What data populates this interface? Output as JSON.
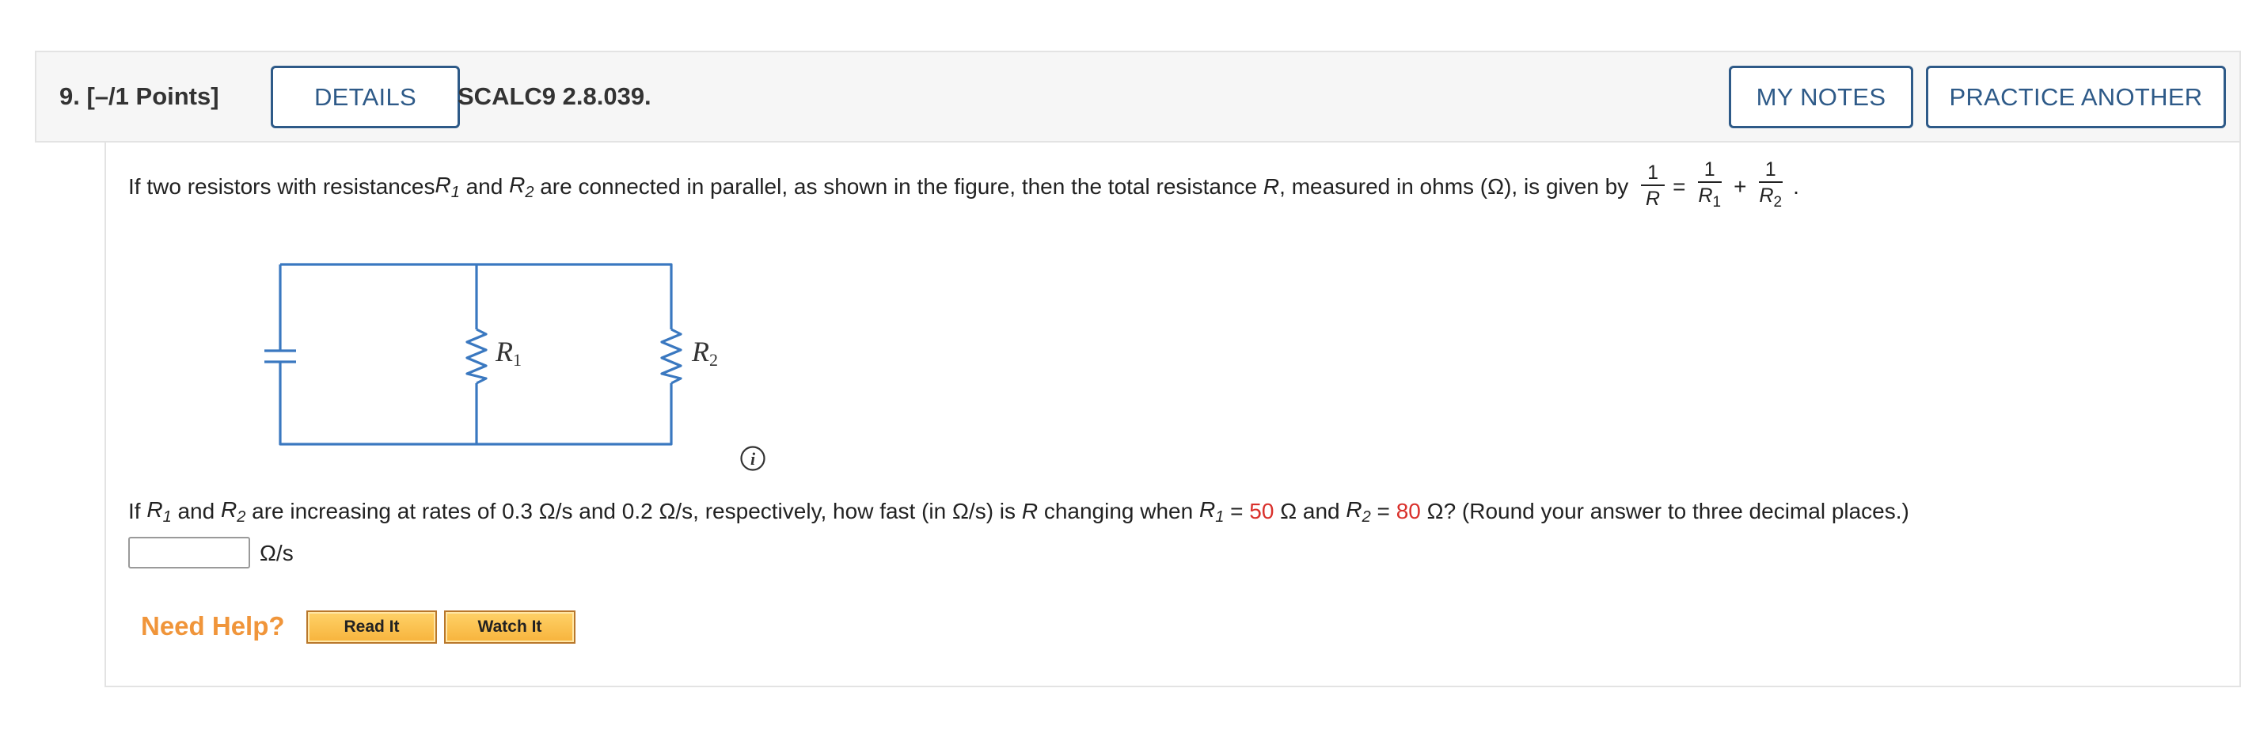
{
  "header": {
    "question_number": "9.",
    "points": "[–/1 Points]",
    "details_label": "DETAILS",
    "code": "SCALC9 2.8.039.",
    "my_notes_label": "MY NOTES",
    "practice_label": "PRACTICE ANOTHER"
  },
  "problem": {
    "intro_1": "If two resistors with resistances ",
    "R": "R",
    "sub1": "1",
    "sub2": "2",
    "and": " and ",
    "intro_2": " are connected in parallel, as shown in the figure, then the total resistance ",
    "intro_3": ", measured in ohms (Ω), is given by ",
    "formula": {
      "one": "1",
      "R": "R",
      "eq": "=",
      "plus": "+",
      "period": "."
    },
    "figure": {
      "label_r1": "R",
      "label_r1_sub": "1",
      "label_r2": "R",
      "label_r2_sub": "2",
      "info_icon": "info-icon"
    },
    "question_1": "If ",
    "question_2": " are increasing at rates of 0.3 Ω/s and 0.2 Ω/s, respectively, how fast (in Ω/s) is ",
    "question_3": " changing when ",
    "eq_sign": " = ",
    "value_r1": "50",
    "ohm_and": " Ω and ",
    "value_r2": "80",
    "question_4": " Ω? (Round your answer to three decimal places.)",
    "answer_value": "",
    "answer_unit": "Ω/s"
  },
  "help": {
    "need_help": "Need Help?",
    "read_it": "Read It",
    "watch_it": "Watch It"
  },
  "colors": {
    "accent": "#2e5a88",
    "red_value": "#d9302b",
    "help_orange": "#f0953a",
    "circuit": "#3a78c0"
  }
}
